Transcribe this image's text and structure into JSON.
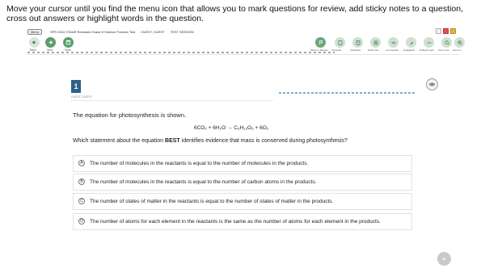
{
  "instruction": "Move your cursor until you find the menu icon that allows you to mark questions for review, add sticky notes to a question, cross out answers or highlight words in the question.",
  "toolbar": {
    "menu_label": "Menu",
    "test_title": "SPR 2024 STAAR Released Grade 8 Science Practice Test",
    "student_info": "GUEST, GUEST",
    "session_info": "TEST SESSION",
    "back_label": "Back",
    "next_label": "Next",
    "save_label": "Save",
    "tool_labels": [
      "Mark for Review",
      "Notepad",
      "Calculator",
      "Reference",
      "Line Reader",
      "Highlighter",
      "Strikethrough",
      "Zoom Out",
      "Zoom In"
    ]
  },
  "question": {
    "number": "1",
    "subheader": "GUEST, GUEST",
    "stem": "The equation for photosynthesis is shown.",
    "equation": "6CO₂ + 6H₂O  →  C₆H₁₂O₆ + 6O₂",
    "prompt_before": "Which statement about the equation ",
    "prompt_bold": "BEST",
    "prompt_after": " identifies evidence that mass is conserved during photosynthesis?",
    "choices": [
      {
        "letter": "A",
        "text": "The number of molecules in the reactants is equal to the number of molecules in the products."
      },
      {
        "letter": "B",
        "text": "The number of molecules in the reactants is equal to the number of carbon atoms in the products."
      },
      {
        "letter": "C",
        "text": "The number of states of matter in the reactants is equal to the number of states of matter in the products."
      },
      {
        "letter": "D",
        "text": "The number of atoms for each element in the reactants is the same as the number of atoms for each element in the products."
      }
    ]
  },
  "icons": {
    "back": "arrow-left-icon",
    "next": "arrow-right-icon",
    "save": "save-icon",
    "eye": "eye-icon",
    "scroll": "chevron-down-icon"
  },
  "colors": {
    "accent": "#2e5f8a",
    "button_green": "#5b9e6b",
    "button_green_light": "#cfe0d3"
  }
}
